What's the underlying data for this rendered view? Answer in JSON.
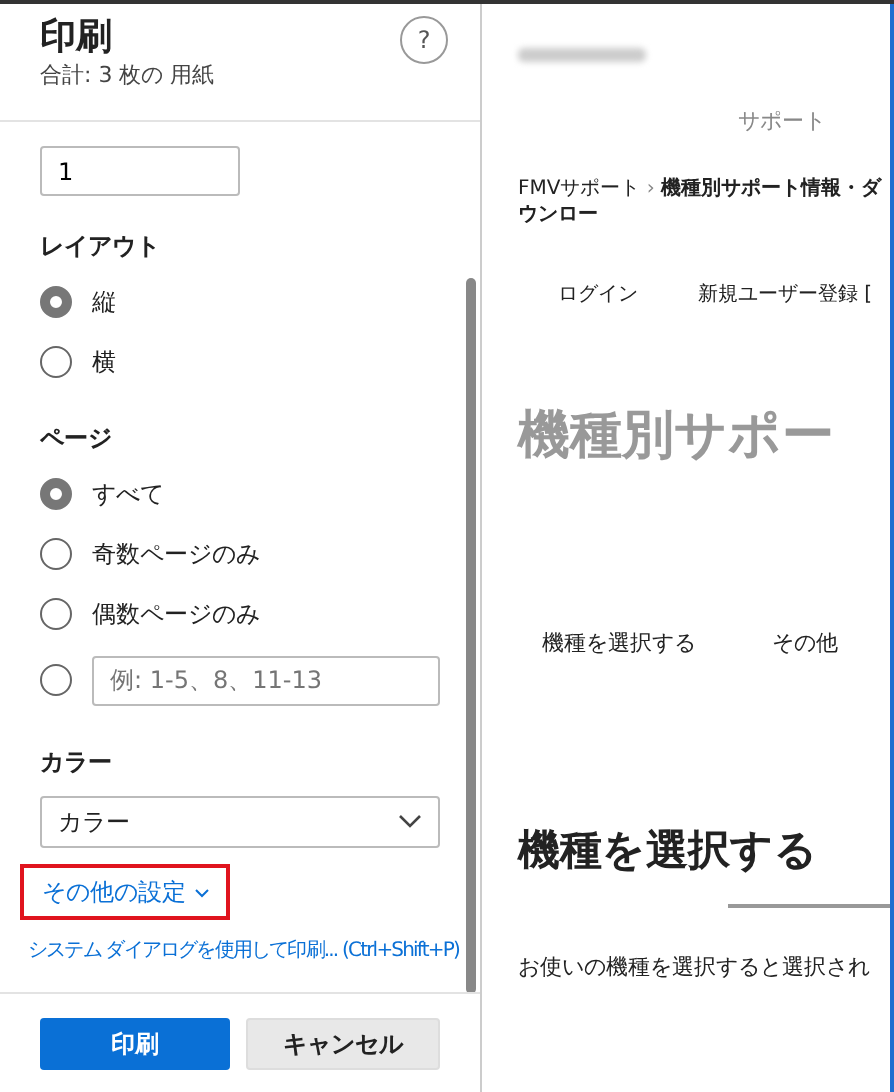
{
  "dialog": {
    "title": "印刷",
    "subtitle": "合計: 3 枚の 用紙",
    "help": "?",
    "copies": {
      "value": "1"
    },
    "sections": [
      {
        "kind": "radios",
        "label": "レイアウト",
        "options": [
          {
            "kind": "radio",
            "label": "縦",
            "selected": true
          },
          {
            "kind": "radio",
            "label": "横",
            "selected": false
          }
        ]
      },
      {
        "kind": "radios",
        "label": "ページ",
        "options": [
          {
            "kind": "radio",
            "label": "すべて",
            "selected": true
          },
          {
            "kind": "radio",
            "label": "奇数ページのみ",
            "selected": false
          },
          {
            "kind": "radio",
            "label": "偶数ページのみ",
            "selected": false
          },
          {
            "kind": "range",
            "placeholder": "例: 1-5、8、11-13",
            "selected": false
          }
        ]
      },
      {
        "kind": "select",
        "label": "カラー",
        "value": "カラー"
      }
    ],
    "more_settings": {
      "label": "その他の設定",
      "highlighted": true
    },
    "system_dialog_link": "システム ダイアログを使用して印刷... (Ctrl+Shift+P)",
    "buttons": [
      {
        "kind": "primary",
        "label": "印刷"
      },
      {
        "kind": "secondary",
        "label": "キャンセル"
      }
    ]
  },
  "preview": {
    "site_label": "サポート",
    "breadcrumb": {
      "home": "FMVサポート",
      "separator": "›",
      "current": "機種別サポート情報・ダウンロー"
    },
    "nav_links": [
      "ログイン",
      "新規ユーザー登録 ["
    ],
    "page_title": "機種別サポー",
    "tabs": [
      "機種を選択する",
      "その他"
    ],
    "section_title": "機種を選択する",
    "intro": "お使いの機種を選択すると選択され"
  }
}
